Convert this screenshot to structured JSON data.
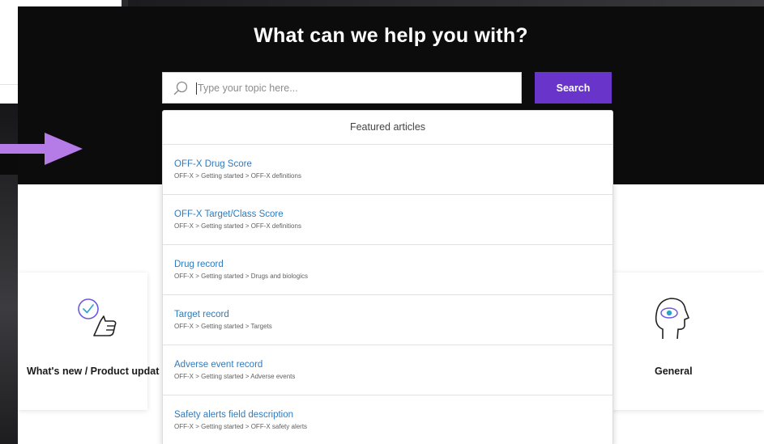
{
  "hero": {
    "title": "What can we help you with?"
  },
  "search": {
    "placeholder": "Type your topic here...",
    "button_label": "Search",
    "icon": "search-icon"
  },
  "dropdown": {
    "header": "Featured articles",
    "articles": [
      {
        "title": "OFF-X Drug Score",
        "path": "OFF-X > Getting started > OFF-X definitions"
      },
      {
        "title": "OFF-X Target/Class Score",
        "path": "OFF-X > Getting started > OFF-X definitions"
      },
      {
        "title": "Drug record",
        "path": "OFF-X > Getting started > Drugs and biologics"
      },
      {
        "title": "Target record",
        "path": "OFF-X > Getting started > Targets"
      },
      {
        "title": "Adverse event record",
        "path": "OFF-X > Getting started > Adverse events"
      },
      {
        "title": "Safety alerts field description",
        "path": "OFF-X > Getting started > OFF-X safety alerts"
      }
    ]
  },
  "categories": [
    {
      "label": "What's new / Product updat",
      "icon": "thumbs-up-check-icon"
    },
    {
      "label": "General",
      "icon": "head-eye-icon"
    }
  ],
  "colors": {
    "accent": "#6934c9",
    "link": "#2f7bbf",
    "hero_bg": "#0c0c0d",
    "arrow": "#b57be6"
  }
}
